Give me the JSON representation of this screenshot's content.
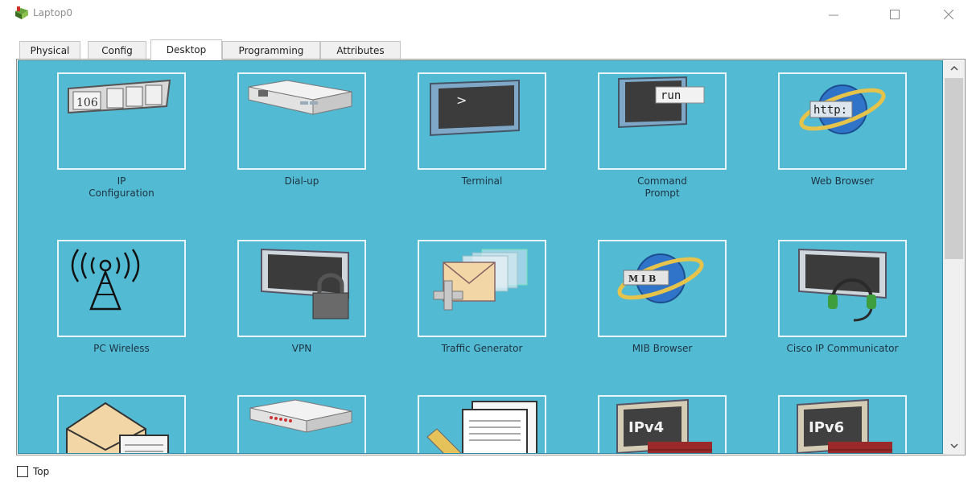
{
  "window": {
    "title": "Laptop0",
    "app_icon": "packet-tracer-laptop-icon",
    "controls": [
      "minimize-icon",
      "maximize-icon",
      "close-icon"
    ]
  },
  "tabs": [
    {
      "label": "Physical",
      "active": false
    },
    {
      "label": "Config",
      "active": false
    },
    {
      "label": "Desktop",
      "active": true
    },
    {
      "label": "Programming",
      "active": false
    },
    {
      "label": "Attributes",
      "active": false
    }
  ],
  "desktop": {
    "background": "#53bad4",
    "apps": [
      {
        "label": "IP\nConfiguration",
        "icon": "ip-configuration-icon"
      },
      {
        "label": "Dial-up",
        "icon": "dial-up-modem-icon"
      },
      {
        "label": "Terminal",
        "icon": "terminal-icon"
      },
      {
        "label": "Command\nPrompt",
        "icon": "command-prompt-icon"
      },
      {
        "label": "Web Browser",
        "icon": "web-browser-icon"
      },
      {
        "label": "PC Wireless",
        "icon": "wireless-antenna-icon"
      },
      {
        "label": "VPN",
        "icon": "vpn-lock-icon"
      },
      {
        "label": "Traffic Generator",
        "icon": "traffic-generator-icon"
      },
      {
        "label": "MIB Browser",
        "icon": "mib-browser-icon"
      },
      {
        "label": "Cisco IP Communicator",
        "icon": "ip-communicator-headset-icon"
      },
      {
        "label": "",
        "icon": "email-icon"
      },
      {
        "label": "",
        "icon": "pppoe-dialer-icon"
      },
      {
        "label": "",
        "icon": "text-editor-icon"
      },
      {
        "label": "",
        "icon": "ipv4-firewall-icon"
      },
      {
        "label": "",
        "icon": "ipv6-firewall-icon"
      }
    ],
    "icon_text": {
      "ip_number": "106",
      "terminal_prompt": ">",
      "run": "run",
      "http": "http:",
      "mib": "M I B",
      "ipv4": "IPv4",
      "ipv6": "IPv6"
    }
  },
  "footer": {
    "top_checkbox_label": "Top",
    "top_checked": false
  }
}
